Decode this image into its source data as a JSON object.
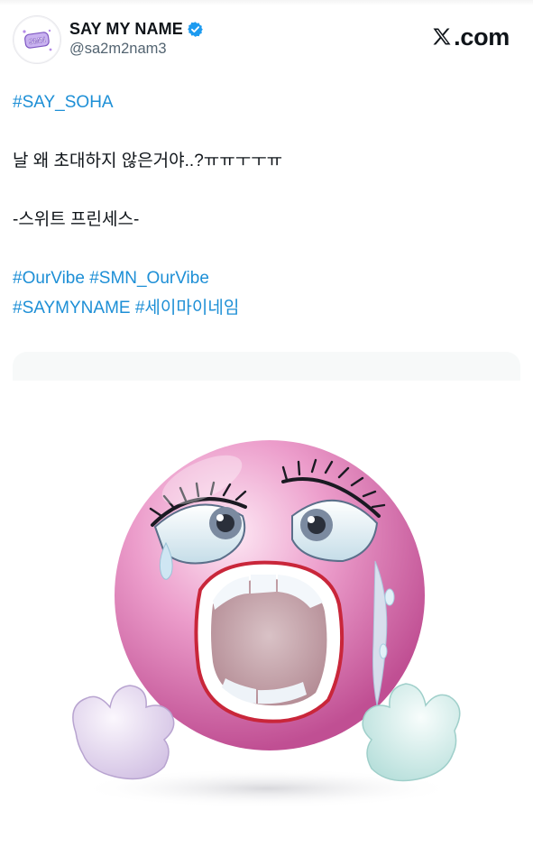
{
  "author": {
    "display_name": "SAY MY NAME",
    "handle": "@sa2m2nam3",
    "avatar_icon": "say-my-name-logo",
    "verified_icon": "verified-badge-icon",
    "verified_color": "#1d9bf0"
  },
  "brand": {
    "logo_icon": "x-logo-icon",
    "text": ".com"
  },
  "tweet": {
    "lines": [
      "#SAY_SOHA",
      "날 왜 초대하지 않은거야..?ㅠㅠㅜㅜㅠ",
      "-스위트 프린세스-",
      "#OurVibe #SMN_OurVibe",
      "#SAYMYNAME #세이마이네임"
    ],
    "hashtag_color": "#1d8fd6"
  },
  "media": {
    "image_icon": "crying-pink-emoji-image"
  }
}
